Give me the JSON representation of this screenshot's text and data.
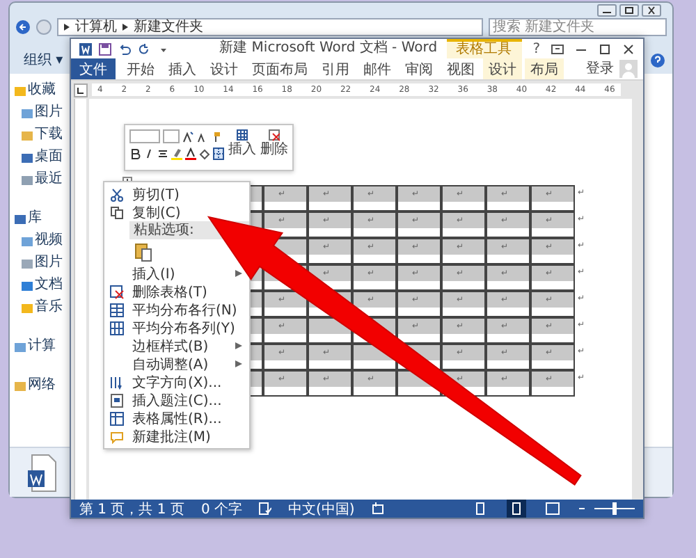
{
  "explorer": {
    "address": [
      "计算机",
      "新建文件夹"
    ],
    "search": {
      "placeholder": "搜索 新建文件夹"
    },
    "organize": "组织 ▾",
    "sidebar": [
      {
        "label": "收藏",
        "children": [
          {
            "label": "图片"
          },
          {
            "label": "下载"
          },
          {
            "label": "桌面"
          },
          {
            "label": "最近"
          }
        ]
      },
      {
        "label": "库",
        "children": [
          {
            "label": "视频"
          },
          {
            "label": "图片"
          },
          {
            "label": "文档"
          },
          {
            "label": "音乐"
          }
        ]
      },
      {
        "label": "计算"
      },
      {
        "label": "网络"
      }
    ]
  },
  "word": {
    "title": "新建 Microsoft Word 文档 - Word",
    "context_group": "表格工具",
    "help": "?",
    "account": "登录",
    "tabs": [
      {
        "label": "文件",
        "kind": "file"
      },
      {
        "label": "开始",
        "kind": "plain"
      },
      {
        "label": "插入",
        "kind": "plain"
      },
      {
        "label": "设计",
        "kind": "plain"
      },
      {
        "label": "页面布局",
        "kind": "plain"
      },
      {
        "label": "引用",
        "kind": "plain"
      },
      {
        "label": "邮件",
        "kind": "plain"
      },
      {
        "label": "审阅",
        "kind": "plain"
      },
      {
        "label": "视图",
        "kind": "plain"
      },
      {
        "label": "设计",
        "kind": "context"
      },
      {
        "label": "布局",
        "kind": "context"
      }
    ],
    "ruler": {
      "labels": [
        "4",
        "2",
        "2",
        "6",
        "10",
        "14",
        "16",
        "18",
        "20",
        "22",
        "24",
        "28",
        "32",
        "36",
        "38",
        "40",
        "42",
        "44",
        "46"
      ]
    },
    "mini_toolbar": {
      "buttons": [
        "插入",
        "删除"
      ]
    },
    "context_menu": {
      "items": [
        {
          "kind": "command",
          "label": "剪切(T)",
          "submenu": false
        },
        {
          "kind": "command",
          "label": "复制(C)",
          "submenu": false
        },
        {
          "kind": "header",
          "label": "粘贴选项:"
        },
        {
          "kind": "paste"
        },
        {
          "kind": "command",
          "label": "插入(I)",
          "submenu": true
        },
        {
          "kind": "command",
          "label": "删除表格(T)",
          "submenu": false
        },
        {
          "kind": "command",
          "label": "平均分布各行(N)",
          "submenu": false
        },
        {
          "kind": "command",
          "label": "平均分布各列(Y)",
          "submenu": false
        },
        {
          "kind": "command",
          "label": "边框样式(B)",
          "submenu": true
        },
        {
          "kind": "command",
          "label": "自动调整(A)",
          "submenu": true
        },
        {
          "kind": "command",
          "label": "文字方向(X)...",
          "submenu": false
        },
        {
          "kind": "command",
          "label": "插入题注(C)...",
          "submenu": false
        },
        {
          "kind": "command",
          "label": "表格属性(R)...",
          "submenu": false
        },
        {
          "kind": "command",
          "label": "新建批注(M)",
          "submenu": false
        }
      ]
    },
    "table": {
      "rows": [
        {
          "cells": [
            {
              "text": "↵"
            },
            {
              "text": "↵"
            },
            {
              "text": "↵"
            },
            {
              "text": "↵"
            },
            {
              "text": "↵"
            },
            {
              "text": "↵"
            },
            {
              "text": "↵"
            }
          ],
          "end_mark": "↵"
        },
        {
          "cells": [
            {
              "text": "↵"
            },
            {
              "text": "↵"
            },
            {
              "text": "↵"
            },
            {
              "text": "↵"
            },
            {
              "text": "↵"
            },
            {
              "text": "↵"
            },
            {
              "text": "↵"
            }
          ],
          "end_mark": "↵"
        },
        {
          "cells": [
            {
              "covered": true
            },
            {
              "text": "↵"
            },
            {
              "text": "↵"
            },
            {
              "text": "↵"
            },
            {
              "text": "↵"
            },
            {
              "text": "↵"
            },
            {
              "text": "↵"
            }
          ],
          "end_mark": "↵"
        },
        {
          "cells": [
            {
              "covered": true
            },
            {
              "text": "↵"
            },
            {
              "text": "↵"
            },
            {
              "text": "↵"
            },
            {
              "text": "↵"
            },
            {
              "text": "↵"
            },
            {
              "text": "↵"
            }
          ],
          "end_mark": "↵"
        },
        {
          "cells": [
            {
              "text": "↵"
            },
            {
              "covered": true
            },
            {
              "text": "↵"
            },
            {
              "text": "↵"
            },
            {
              "text": "↵"
            },
            {
              "text": "↵"
            },
            {
              "text": "↵"
            }
          ],
          "end_mark": "↵"
        },
        {
          "cells": [
            {
              "text": "↵"
            },
            {
              "covered": true
            },
            {
              "covered": true
            },
            {
              "text": "↵"
            },
            {
              "text": "↵"
            },
            {
              "text": "↵"
            },
            {
              "text": "↵"
            }
          ],
          "end_mark": "↵"
        },
        {
          "cells": [
            {
              "text": "↵"
            },
            {
              "text": "↵"
            },
            {
              "covered": true
            },
            {
              "covered": true
            },
            {
              "text": "↵"
            },
            {
              "text": "↵"
            },
            {
              "text": "↵"
            }
          ],
          "end_mark": "↵"
        },
        {
          "cells": [
            {
              "text": "↵"
            },
            {
              "text": "↵"
            },
            {
              "text": "↵"
            },
            {
              "covered": true
            },
            {
              "text": "↵"
            },
            {
              "text": "↵"
            },
            {
              "text": "↵"
            }
          ],
          "end_mark": "↵"
        }
      ]
    },
    "status_bar": {
      "page": "第 1 页，共 1 页",
      "words": "0 个字",
      "language": "中文(中国)",
      "views": [
        {
          "selected": false
        },
        {
          "selected": true
        },
        {
          "selected": false
        }
      ],
      "zoom": {
        "level": 0.5
      }
    }
  }
}
